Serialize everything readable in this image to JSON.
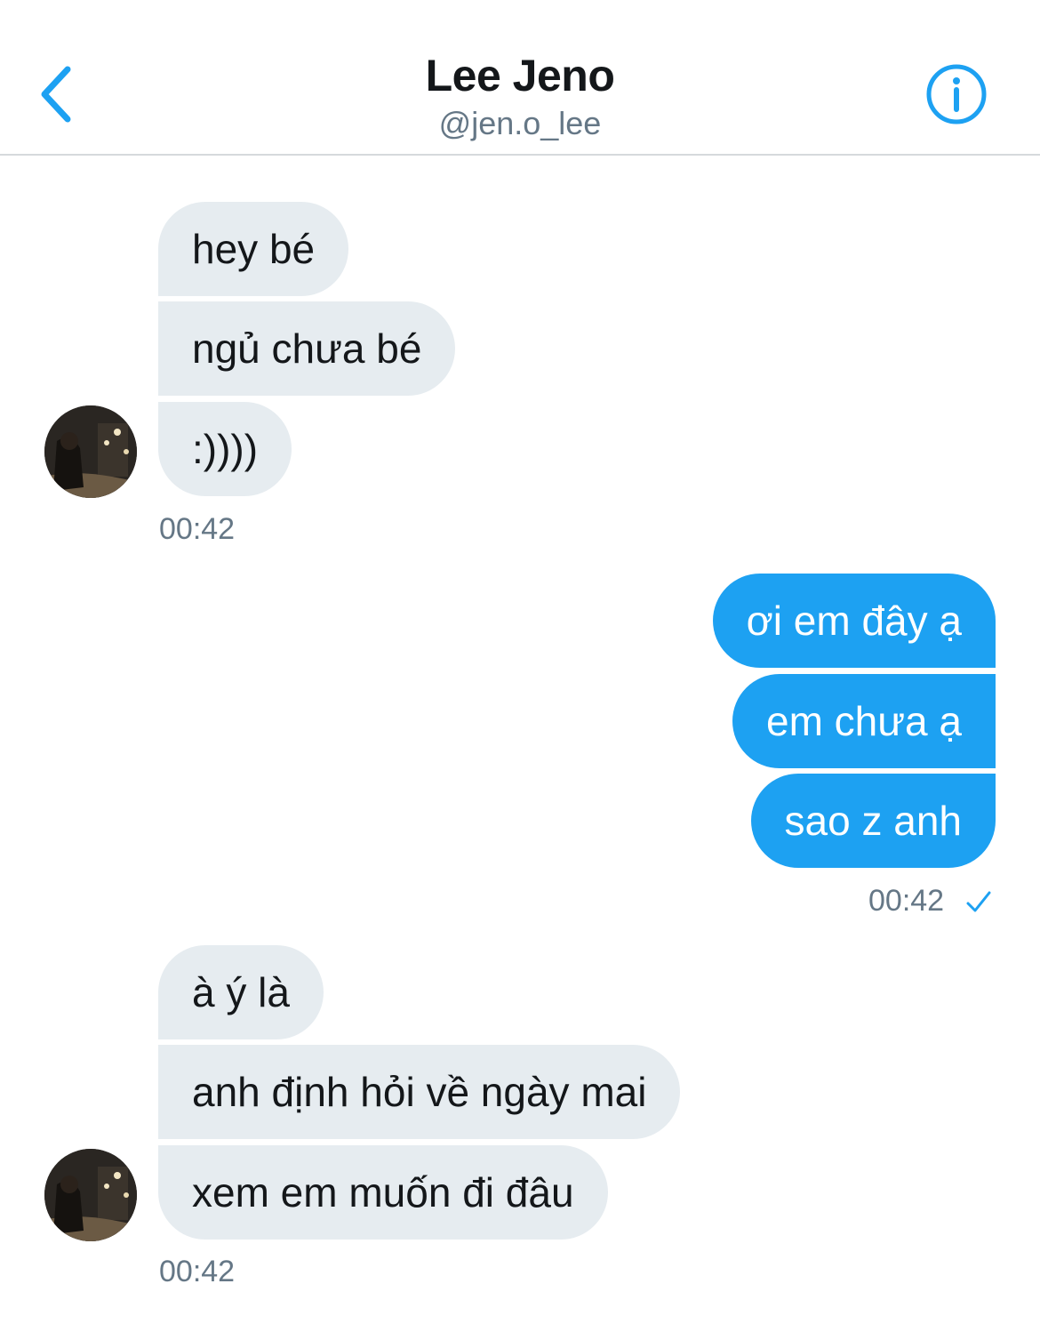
{
  "header": {
    "title": "Lee Jeno",
    "handle": "@jen.o_lee",
    "back_icon": "chevron-left-icon",
    "info_icon": "info-circle-icon",
    "accent": "#1da1f2"
  },
  "colors": {
    "incoming_bubble": "#e6ecf0",
    "outgoing_bubble": "#1da1f2",
    "timestamp": "#657786"
  },
  "messages": {
    "group1": {
      "m1": "hey bé",
      "m2": "ngủ chưa bé",
      "m3": ":))))",
      "time": "00:42"
    },
    "group2": {
      "m1": "ơi em đây ạ",
      "m2": "em chưa ạ",
      "m3": "sao z anh",
      "time": "00:42",
      "status_icon": "checkmark-icon"
    },
    "group3": {
      "m1": "à ý là",
      "m2": "anh định hỏi về ngày mai",
      "m3": "xem em muốn đi đâu",
      "time": "00:42"
    }
  }
}
